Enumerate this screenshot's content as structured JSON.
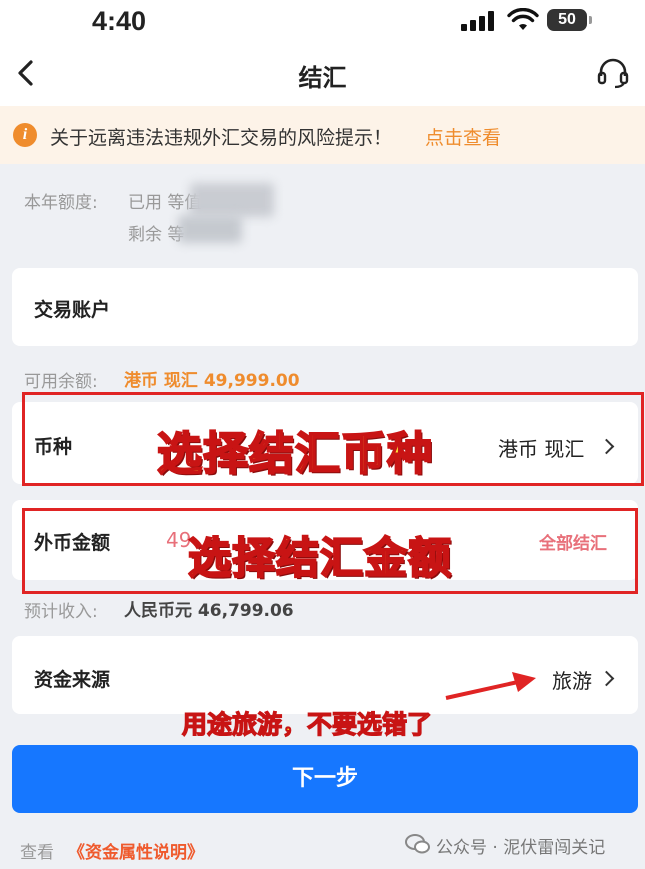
{
  "status": {
    "time": "4:40",
    "battery": "50"
  },
  "nav": {
    "title": "结汇",
    "back_icon": "chevron-left-icon",
    "service_icon": "headset-icon"
  },
  "notice": {
    "text": "关于远离违法违规外汇交易的风险提示！",
    "link": "点击查看"
  },
  "quota": {
    "label": "本年额度:",
    "used": "已用 等值",
    "remaining": "剩余 等"
  },
  "account": {
    "label": "交易账户"
  },
  "available": {
    "label": "可用余额:",
    "value": "港币 现汇 49,999.00"
  },
  "currency": {
    "label": "币种",
    "value": "港币 现汇"
  },
  "amount": {
    "label": "外币金额",
    "value": "49",
    "all_button": "全部结汇"
  },
  "estimate": {
    "label": "预计收入:",
    "value": "人民币元 46,799.06"
  },
  "source": {
    "label": "资金来源",
    "value": "旅游"
  },
  "annotations": {
    "currency": "选择结汇币种",
    "amount": "选择结汇金额",
    "purpose": "用途旅游，不要选错了"
  },
  "next_button": "下一步",
  "footer": {
    "see": "查看",
    "link": "《资金属性说明》",
    "watermark": "公众号 · 泥伏雷闯关记"
  },
  "colors": {
    "accent": "#1677ff",
    "orange": "#ef8c2d",
    "annotation_red": "#e02424"
  }
}
